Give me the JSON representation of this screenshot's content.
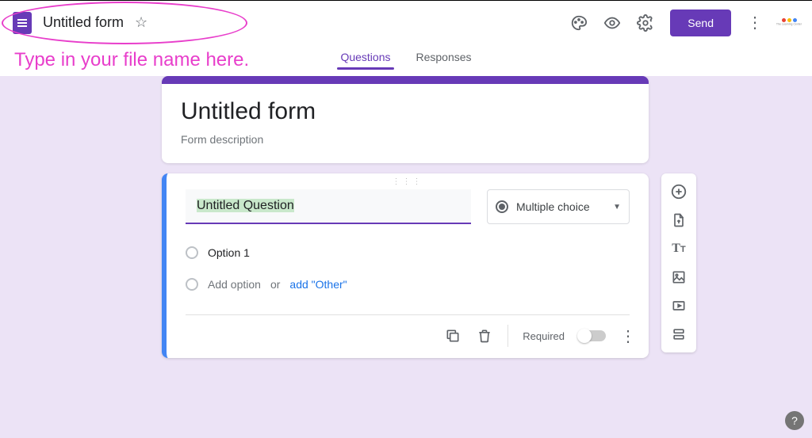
{
  "header": {
    "doc_title": "Untitled form",
    "send_label": "Send"
  },
  "tabs": {
    "questions": "Questions",
    "responses": "Responses"
  },
  "title_card": {
    "title": "Untitled form",
    "description": "Form description"
  },
  "question": {
    "title": "Untitled Question",
    "type_label": "Multiple choice",
    "option1": "Option 1",
    "add_option": "Add option",
    "or": "or",
    "add_other": "add \"Other\"",
    "required_label": "Required"
  },
  "annotation": {
    "hint": "Type in your file name here."
  },
  "logo_caption": "The Learning Center"
}
